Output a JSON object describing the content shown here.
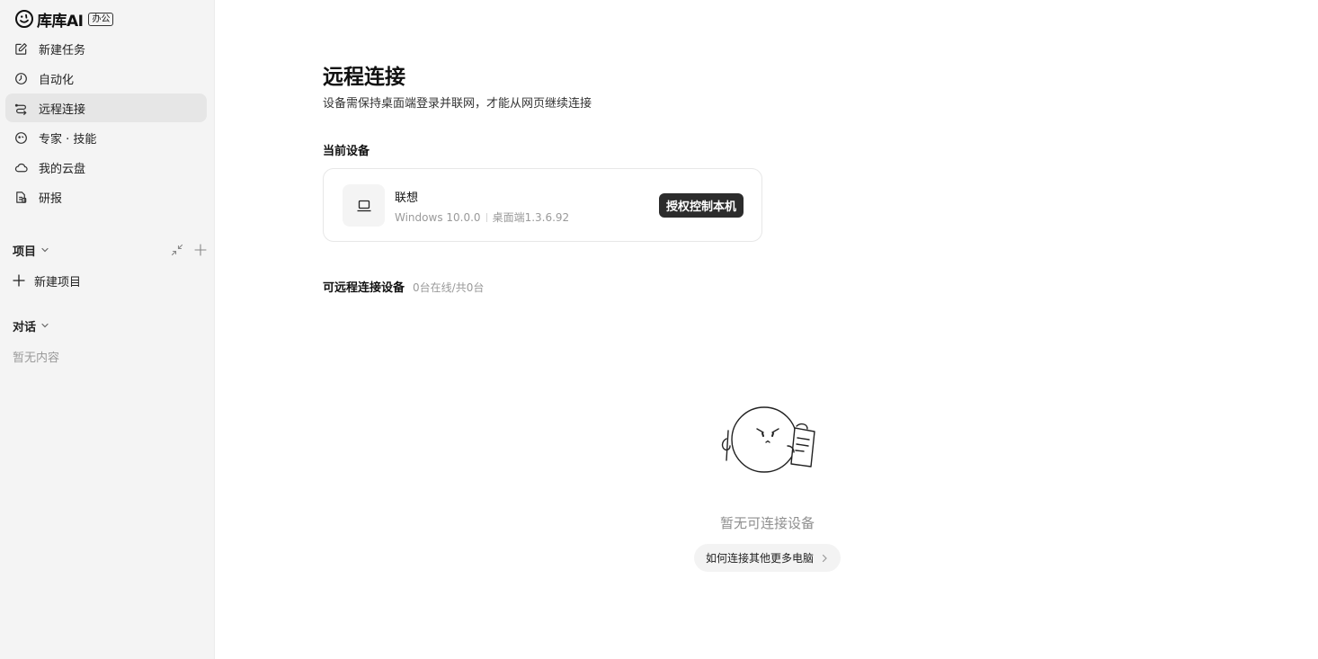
{
  "app": {
    "name": "库库AI",
    "badge": "办公"
  },
  "sidebar": {
    "items": [
      {
        "label": "新建任务",
        "icon": "edit-icon"
      },
      {
        "label": "自动化",
        "icon": "clock-icon"
      },
      {
        "label": "远程连接",
        "icon": "remote-icon",
        "active": true
      },
      {
        "label": "专家 · 技能",
        "icon": "expert-icon"
      },
      {
        "label": "我的云盘",
        "icon": "cloud-icon"
      },
      {
        "label": "研报",
        "icon": "report-icon"
      }
    ],
    "projects": {
      "title": "项目",
      "new_label": "新建项目"
    },
    "conversations": {
      "title": "对话",
      "empty": "暂无内容"
    }
  },
  "main": {
    "title": "远程连接",
    "subtitle": "设备需保持桌面端登录并联网，才能从网页继续连接",
    "current_device": {
      "heading": "当前设备",
      "name": "联想",
      "os": "Windows 10.0.0",
      "client": "桌面端1.3.6.92",
      "button": "授权控制本机"
    },
    "remote_devices": {
      "heading": "可远程连接设备",
      "count": "0台在线/共0台",
      "empty": "暂无可连接设备",
      "help_button": "如何连接其他更多电脑"
    }
  },
  "colors": {
    "sidebar_bg": "#f4f4f4",
    "active_item_bg": "#e6e6e6",
    "primary_button": "#2c2c2c",
    "muted_text": "#9a9a9a"
  }
}
